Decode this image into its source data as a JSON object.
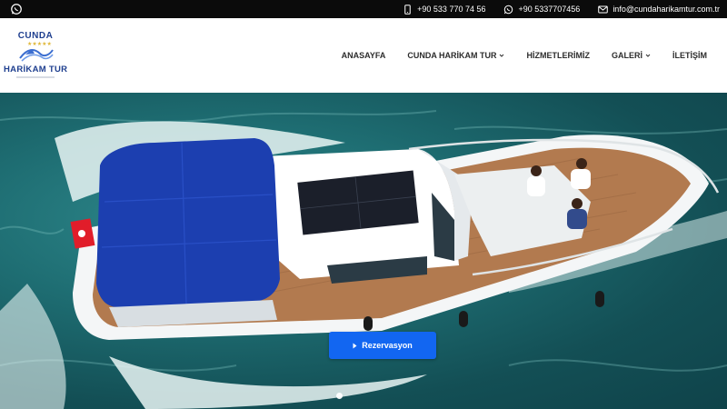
{
  "topbar": {
    "left_icon": "whatsapp-icon",
    "phone": {
      "icon": "phone-icon",
      "text": "+90 533 770 74 56"
    },
    "whatsapp": {
      "icon": "whatsapp-icon",
      "text": "+90 5337707456"
    },
    "email": {
      "icon": "mail-icon",
      "text": "info@cundaharikamtur.com.tr"
    }
  },
  "logo": {
    "top_text": "CUNDA",
    "main_text": "HARİKAM TUR"
  },
  "nav": {
    "items": [
      {
        "label": "ANASAYFA",
        "has_dropdown": false
      },
      {
        "label": "CUNDA HARİKAM TUR",
        "has_dropdown": true
      },
      {
        "label": "HİZMETLERİMİZ",
        "has_dropdown": false
      },
      {
        "label": "GALERİ",
        "has_dropdown": true
      },
      {
        "label": "İLETİŞİM",
        "has_dropdown": false
      }
    ]
  },
  "hero": {
    "cta_label": "Rezervasyon",
    "cta_icon": "caret-right-icon",
    "slide_count": 1,
    "active_slide": 1
  },
  "colors": {
    "topbar_bg": "#0b0b0b",
    "cta_bg": "#1266f1",
    "brand_blue": "#1f3f8f",
    "sea": "#1e6d72",
    "boat_canopy": "#1c3fb0"
  }
}
